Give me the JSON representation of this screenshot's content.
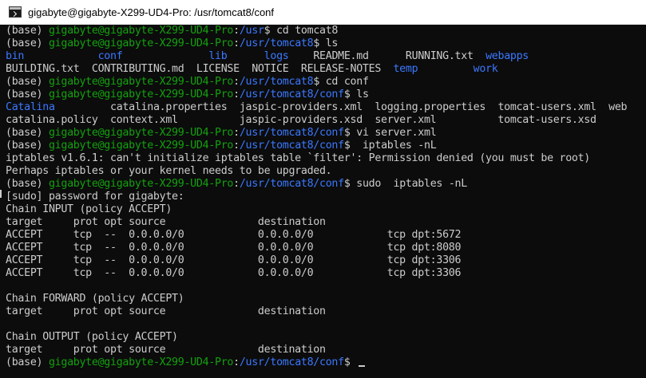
{
  "window": {
    "title": "gigabyte@gigabyte-X299-UD4-Pro: /usr/tomcat8/conf"
  },
  "terminal": {
    "colors": {
      "background": "#0c0c0c",
      "text": "#cccccc",
      "prompt_user": "#13a10e",
      "prompt_path": "#3b78ff",
      "directory": "#3b78ff"
    },
    "lines": [
      [
        {
          "t": "(base) ",
          "c": "w"
        },
        {
          "t": "gigabyte@gigabyte-X299-UD4-Pro",
          "c": "g"
        },
        {
          "t": ":",
          "c": "w"
        },
        {
          "t": "/usr",
          "c": "b"
        },
        {
          "t": "$ cd tomcat8",
          "c": "w"
        }
      ],
      [
        {
          "t": "(base) ",
          "c": "w"
        },
        {
          "t": "gigabyte@gigabyte-X299-UD4-Pro",
          "c": "g"
        },
        {
          "t": ":",
          "c": "w"
        },
        {
          "t": "/usr/tomcat8",
          "c": "b"
        },
        {
          "t": "$ ls",
          "c": "w"
        }
      ],
      [
        {
          "t": "bin",
          "c": "b"
        },
        {
          "t": "            ",
          "c": "w"
        },
        {
          "t": "conf",
          "c": "b"
        },
        {
          "t": "              ",
          "c": "w"
        },
        {
          "t": "lib",
          "c": "b"
        },
        {
          "t": "      ",
          "c": "w"
        },
        {
          "t": "logs",
          "c": "b"
        },
        {
          "t": "    README.md      RUNNING.txt  ",
          "c": "w"
        },
        {
          "t": "webapps",
          "c": "b"
        }
      ],
      [
        {
          "t": "BUILDING.txt  CONTRIBUTING.md  LICENSE  NOTICE  RELEASE-NOTES  ",
          "c": "w"
        },
        {
          "t": "temp",
          "c": "b"
        },
        {
          "t": "         ",
          "c": "w"
        },
        {
          "t": "work",
          "c": "b"
        }
      ],
      [
        {
          "t": "(base) ",
          "c": "w"
        },
        {
          "t": "gigabyte@gigabyte-X299-UD4-Pro",
          "c": "g"
        },
        {
          "t": ":",
          "c": "w"
        },
        {
          "t": "/usr/tomcat8",
          "c": "b"
        },
        {
          "t": "$ cd conf",
          "c": "w"
        }
      ],
      [
        {
          "t": "(base) ",
          "c": "w"
        },
        {
          "t": "gigabyte@gigabyte-X299-UD4-Pro",
          "c": "g"
        },
        {
          "t": ":",
          "c": "w"
        },
        {
          "t": "/usr/tomcat8/conf",
          "c": "b"
        },
        {
          "t": "$ ls",
          "c": "w"
        }
      ],
      [
        {
          "t": "Catalina",
          "c": "b"
        },
        {
          "t": "         catalina.properties  jaspic-providers.xml  logging.properties  tomcat-users.xml  web",
          "c": "w"
        }
      ],
      [
        {
          "t": "catalina.policy  context.xml          jaspic-providers.xsd  server.xml          tomcat-users.xsd",
          "c": "w"
        }
      ],
      [
        {
          "t": "(base) ",
          "c": "w"
        },
        {
          "t": "gigabyte@gigabyte-X299-UD4-Pro",
          "c": "g"
        },
        {
          "t": ":",
          "c": "w"
        },
        {
          "t": "/usr/tomcat8/conf",
          "c": "b"
        },
        {
          "t": "$ vi server.xml",
          "c": "w"
        }
      ],
      [
        {
          "t": "(base) ",
          "c": "w"
        },
        {
          "t": "gigabyte@gigabyte-X299-UD4-Pro",
          "c": "g"
        },
        {
          "t": ":",
          "c": "w"
        },
        {
          "t": "/usr/tomcat8/conf",
          "c": "b"
        },
        {
          "t": "$  iptables -nL",
          "c": "w"
        }
      ],
      [
        {
          "t": "iptables v1.6.1: can't initialize iptables table `filter': Permission denied (you must be root)",
          "c": "w"
        }
      ],
      [
        {
          "t": "Perhaps iptables or your kernel needs to be upgraded.",
          "c": "w"
        }
      ],
      [
        {
          "t": "(base) ",
          "c": "w"
        },
        {
          "t": "gigabyte@gigabyte-X299-UD4-Pro",
          "c": "g"
        },
        {
          "t": ":",
          "c": "w"
        },
        {
          "t": "/usr/tomcat8/conf",
          "c": "b"
        },
        {
          "t": "$ sudo  iptables -nL",
          "c": "w"
        }
      ],
      [
        {
          "t": "[sudo] password for gigabyte:",
          "c": "w"
        }
      ],
      [
        {
          "t": "Chain INPUT (policy ACCEPT)",
          "c": "w"
        }
      ],
      [
        {
          "t": "target     prot opt source               destination",
          "c": "w"
        }
      ],
      [
        {
          "t": "ACCEPT     tcp  --  0.0.0.0/0            0.0.0.0/0            tcp dpt:5672",
          "c": "w"
        }
      ],
      [
        {
          "t": "ACCEPT     tcp  --  0.0.0.0/0            0.0.0.0/0            tcp dpt:8080",
          "c": "w"
        }
      ],
      [
        {
          "t": "ACCEPT     tcp  --  0.0.0.0/0            0.0.0.0/0            tcp dpt:3306",
          "c": "w"
        }
      ],
      [
        {
          "t": "ACCEPT     tcp  --  0.0.0.0/0            0.0.0.0/0            tcp dpt:3306",
          "c": "w"
        }
      ],
      [
        {
          "t": "",
          "c": "w"
        }
      ],
      [
        {
          "t": "Chain FORWARD (policy ACCEPT)",
          "c": "w"
        }
      ],
      [
        {
          "t": "target     prot opt source               destination",
          "c": "w"
        }
      ],
      [
        {
          "t": "",
          "c": "w"
        }
      ],
      [
        {
          "t": "Chain OUTPUT (policy ACCEPT)",
          "c": "w"
        }
      ],
      [
        {
          "t": "target     prot opt source               destination",
          "c": "w"
        }
      ],
      [
        {
          "t": "(base) ",
          "c": "w"
        },
        {
          "t": "gigabyte@gigabyte-X299-UD4-Pro",
          "c": "g"
        },
        {
          "t": ":",
          "c": "w"
        },
        {
          "t": "/usr/tomcat8/conf",
          "c": "b"
        },
        {
          "t": "$ ",
          "c": "w"
        }
      ]
    ]
  }
}
